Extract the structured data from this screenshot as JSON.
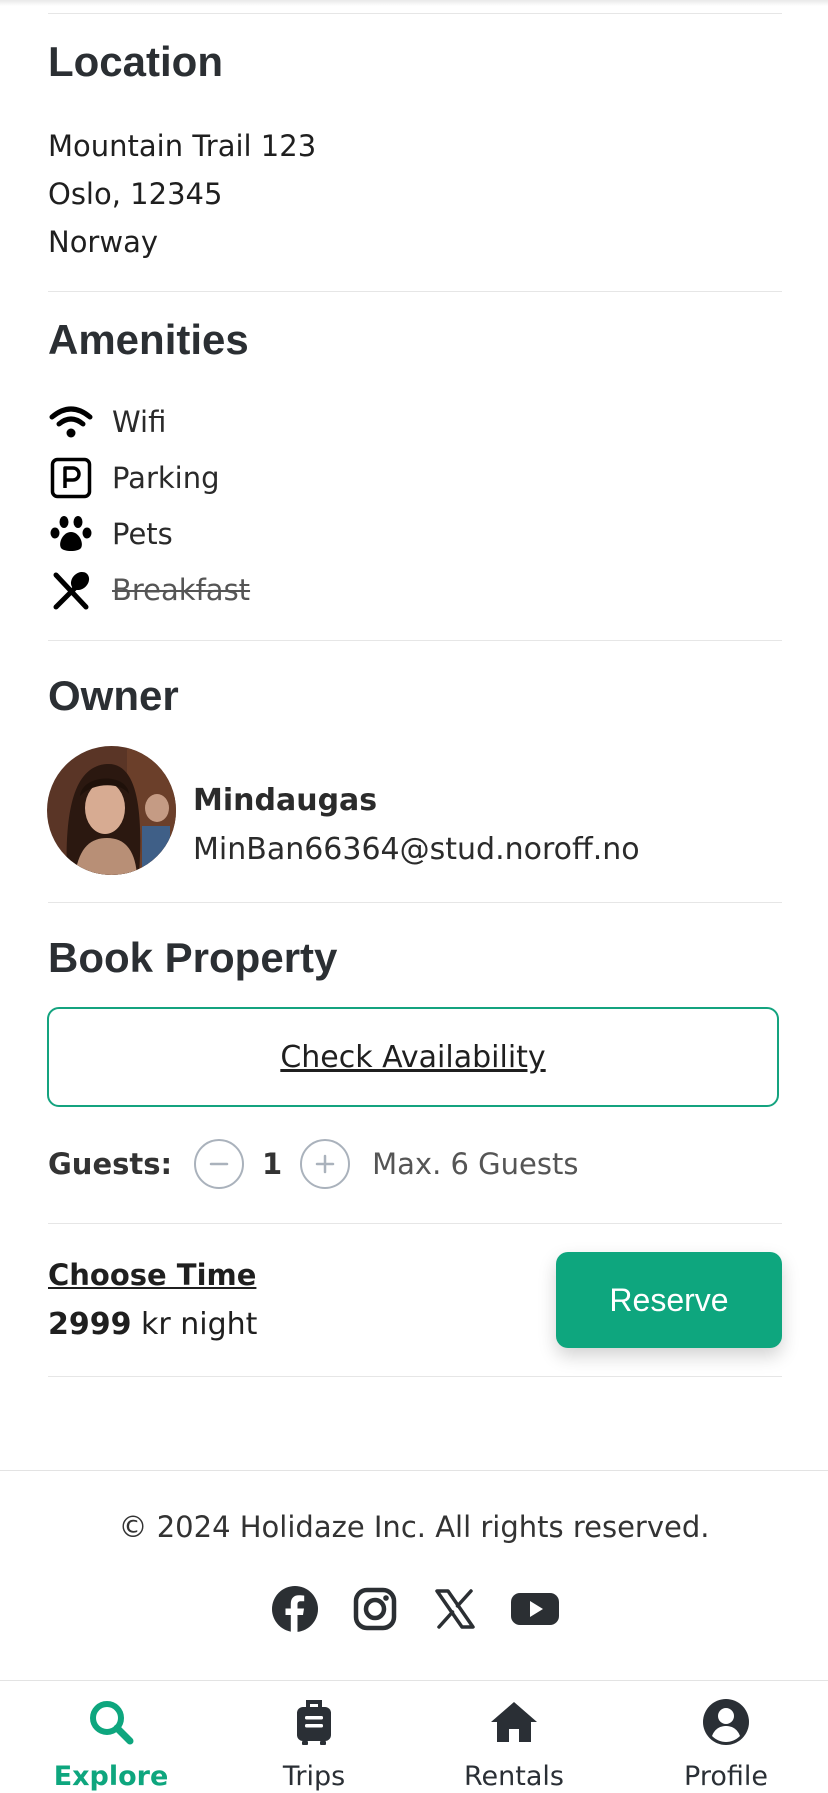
{
  "location": {
    "heading": "Location",
    "address_lines": [
      "Mountain Trail 123",
      "Oslo, 12345",
      "Norway"
    ]
  },
  "amenities": {
    "heading": "Amenities",
    "items": [
      {
        "label": "Wifi",
        "icon": "wifi-icon",
        "available": true
      },
      {
        "label": "Parking",
        "icon": "parking-icon",
        "available": true
      },
      {
        "label": "Pets",
        "icon": "paw-icon",
        "available": true
      },
      {
        "label": "Breakfast",
        "icon": "utensils-icon",
        "available": false
      }
    ]
  },
  "owner": {
    "heading": "Owner",
    "name": "Mindaugas",
    "email": "MinBan66364@stud.noroff.no"
  },
  "booking": {
    "heading": "Book Property",
    "check_availability_label": "Check Availability",
    "guests_label": "Guests:",
    "guest_count": "1",
    "max_guests_text": "Max. 6 Guests",
    "choose_time_label": "Choose Time",
    "price_amount": "2999",
    "price_suffix": " kr night",
    "reserve_label": "Reserve"
  },
  "footer": {
    "copyright": "© 2024 Holidaze Inc. All rights reserved.",
    "social_icons": [
      "facebook-icon",
      "instagram-icon",
      "x-icon",
      "youtube-icon"
    ]
  },
  "bottom_nav": {
    "items": [
      {
        "label": "Explore",
        "icon": "search-icon",
        "active": true
      },
      {
        "label": "Trips",
        "icon": "suitcase-icon",
        "active": false
      },
      {
        "label": "Rentals",
        "icon": "home-icon",
        "active": false
      },
      {
        "label": "Profile",
        "icon": "user-circle-icon",
        "active": false
      }
    ]
  },
  "colors": {
    "accent": "#0ea67e",
    "text": "#212529",
    "divider": "#e6e6e6",
    "stepper_border": "#aab2bc"
  }
}
